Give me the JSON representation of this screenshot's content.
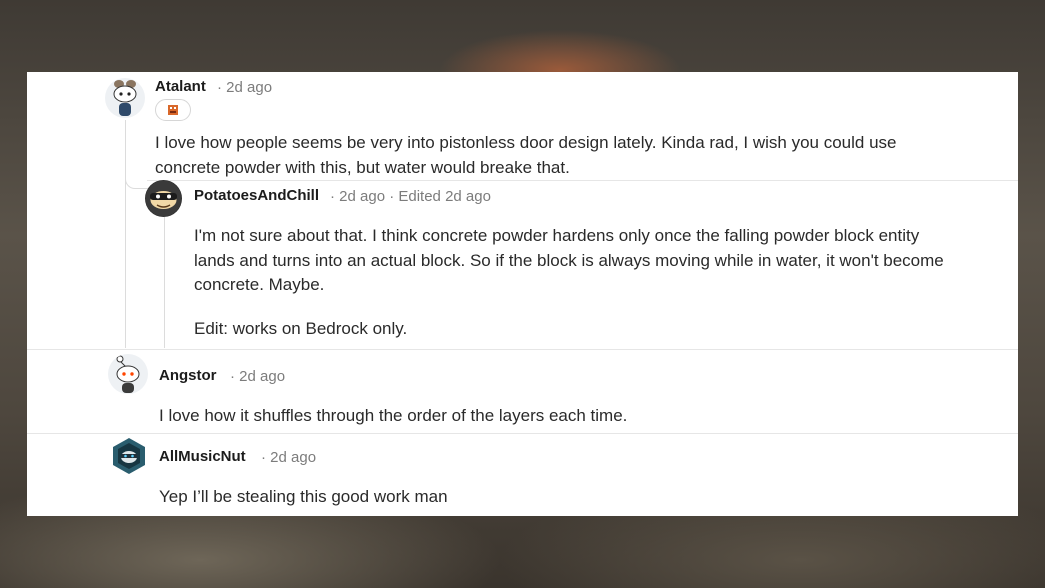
{
  "comments": [
    {
      "user": "Atalant",
      "meta": "· 2d ago",
      "text_lines": [
        "I love how people seems be very into pistonless door design lately. Kinda rad, I wish you could use",
        "concrete powder with this, but water would breake that."
      ]
    },
    {
      "user": "PotatoesAndChill",
      "meta": "· 2d ago · Edited 2d ago",
      "text_lines": [
        "I'm not sure about that. I think concrete powder hardens only once the falling powder block entity",
        "lands and turns into an actual block. So if the block is always moving while in water, it won't become",
        "concrete. Maybe.",
        "Edit: works on Bedrock only."
      ]
    },
    {
      "user": "Angstor",
      "meta": "· 2d ago",
      "text_lines": [
        "I love how it shuffles through the order of the layers each time."
      ]
    },
    {
      "user": "AllMusicNut",
      "meta": "· 2d ago",
      "text_lines": [
        "Yep I’ll be stealing this good work man"
      ]
    }
  ],
  "icons": {
    "atalant_avatar": "snoo-avatar-icon",
    "atalant_flair": "flair-badge-icon",
    "potatoes_avatar": "masked-snoo-avatar-icon",
    "angstor_avatar": "default-snoo-avatar-icon",
    "allmusicnut_avatar": "hooded-snoo-avatar-icon"
  },
  "colors": {
    "username": "#1c1c1c",
    "meta": "#7c7c7c",
    "body": "#2a2a2a",
    "divider": "#e6e6e6"
  }
}
